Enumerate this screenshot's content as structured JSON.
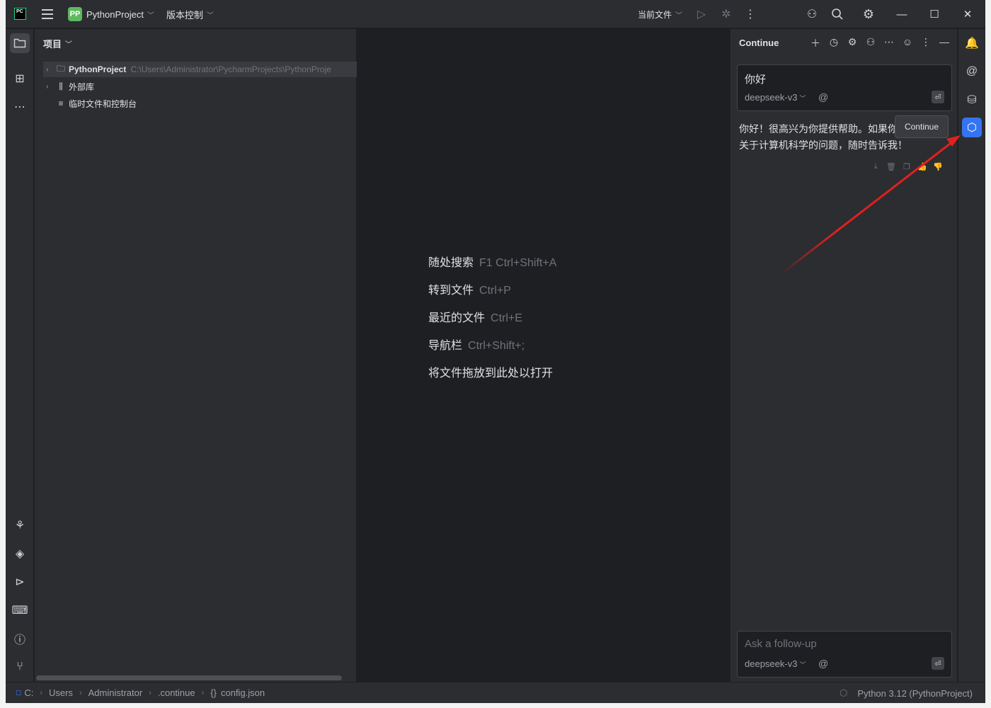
{
  "titlebar": {
    "app_icon": "PC",
    "project_badge": "PP",
    "project_name": "PythonProject",
    "vcs_label": "版本控制",
    "run_config_label": "当前文件",
    "icons": [
      "menu-icon",
      "run-icon",
      "debug-icon",
      "more-vertical-icon",
      "add-user-icon",
      "search-icon",
      "settings-icon"
    ],
    "window_controls": [
      "minimize",
      "maximize",
      "close"
    ]
  },
  "left_stripe": {
    "top_icons": [
      "folder-icon",
      "structure-icon",
      "more-horizontal-icon"
    ],
    "bottom_icons": [
      "python-icon",
      "layers-icon",
      "services-icon",
      "terminal-icon",
      "problems-icon",
      "git-icon"
    ]
  },
  "project_panel": {
    "title": "项目",
    "tree": [
      {
        "label": "PythonProject",
        "path": "C:\\Users\\Administrator\\PycharmProjects\\PythonProje",
        "icon": "folder-icon",
        "expandable": true,
        "selected": true
      },
      {
        "label": "外部库",
        "icon": "library-icon",
        "expandable": true
      },
      {
        "label": "临时文件和控制台",
        "icon": "scratch-icon",
        "expandable": false
      }
    ]
  },
  "editor": {
    "hints": [
      {
        "label": "随处搜索",
        "shortcut": "F1 Ctrl+Shift+A"
      },
      {
        "label": "转到文件",
        "shortcut": "Ctrl+P"
      },
      {
        "label": "最近的文件",
        "shortcut": "Ctrl+E"
      },
      {
        "label": "导航栏",
        "shortcut": "Ctrl+Shift+;"
      },
      {
        "label": "将文件拖放到此处以打开",
        "shortcut": ""
      }
    ]
  },
  "continue_panel": {
    "title": "Continue",
    "header_icons": [
      "plus-icon",
      "history-icon",
      "settings-icon",
      "account-icon",
      "more-horizontal-icon",
      "help-icon",
      "more-vertical-icon",
      "minimize-icon"
    ],
    "user_message": "你好",
    "model": "deepseek-v3",
    "at_symbol": "@",
    "reply_line1": "你好！很高兴为你提供帮助。如果你",
    "reply_line2": "关于计算机科学的问题，随时告诉我！",
    "reply_actions": [
      "apply-icon",
      "delete-icon",
      "copy-icon",
      "thumbs-up-icon",
      "thumbs-down-icon"
    ],
    "followup_placeholder": "Ask a follow-up",
    "followup_model": "deepseek-v3"
  },
  "tooltip": {
    "text": "Continue"
  },
  "right_stripe": {
    "icons": [
      "notifications-icon",
      "ai-assistant-icon",
      "database-icon",
      "continue-icon"
    ]
  },
  "statusbar": {
    "breadcrumbs": [
      "C:",
      "Users",
      "Administrator",
      ".continue",
      "config.json"
    ],
    "interpreter": "Python 3.12 (PythonProject)"
  },
  "colors": {
    "accent": "#3574f0",
    "annotation_arrow": "#e02020",
    "panel_bg": "#2b2d30",
    "editor_bg": "#1e1f22"
  }
}
